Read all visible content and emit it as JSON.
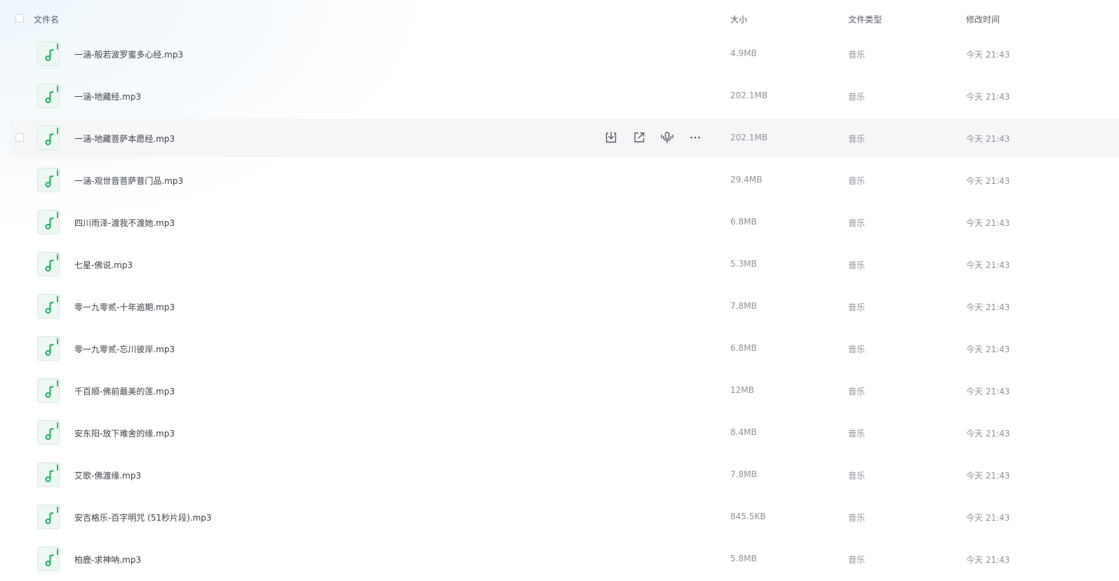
{
  "header": {
    "name_label": "文件名",
    "size_label": "大小",
    "type_label": "文件类型",
    "time_label": "修改时间"
  },
  "colors": {
    "icon_green": "#2db36c",
    "hover_row": "#f5f6f8"
  },
  "row_actions": [
    "download-icon",
    "share-icon",
    "voice-icon",
    "more-icon"
  ],
  "files": [
    {
      "name": "一涵-般若波罗蜜多心经.mp3",
      "size": "4.9MB",
      "type": "音乐",
      "time": "今天 21:43"
    },
    {
      "name": "一涵-地藏经.mp3",
      "size": "202.1MB",
      "type": "音乐",
      "time": "今天 21:43"
    },
    {
      "name": "一涵-地藏菩萨本愿经.mp3",
      "size": "202.1MB",
      "type": "音乐",
      "time": "今天 21:43"
    },
    {
      "name": "一涵-观世音菩萨普门品.mp3",
      "size": "29.4MB",
      "type": "音乐",
      "time": "今天 21:43"
    },
    {
      "name": "四川雨泽-渡我不渡她.mp3",
      "size": "6.8MB",
      "type": "音乐",
      "time": "今天 21:43"
    },
    {
      "name": "七星-佛说.mp3",
      "size": "5.3MB",
      "type": "音乐",
      "time": "今天 21:43"
    },
    {
      "name": "零一九零贰-十年逾期.mp3",
      "size": "7.8MB",
      "type": "音乐",
      "time": "今天 21:43"
    },
    {
      "name": "零一九零贰-忘川彼岸.mp3",
      "size": "6.8MB",
      "type": "音乐",
      "time": "今天 21:43"
    },
    {
      "name": "千百顺-佛前最美的莲.mp3",
      "size": "12MB",
      "type": "音乐",
      "time": "今天 21:43"
    },
    {
      "name": "安东阳-放下难舍的缘.mp3",
      "size": "8.4MB",
      "type": "音乐",
      "time": "今天 21:43"
    },
    {
      "name": "艾歌-佛渡缘.mp3",
      "size": "7.8MB",
      "type": "音乐",
      "time": "今天 21:43"
    },
    {
      "name": "安吉格乐-百字明咒 (51秒片段).mp3",
      "size": "845.5KB",
      "type": "音乐",
      "time": "今天 21:43"
    },
    {
      "name": "柏鹿-求神呐.mp3",
      "size": "5.8MB",
      "type": "音乐",
      "time": "今天 21:43"
    }
  ]
}
